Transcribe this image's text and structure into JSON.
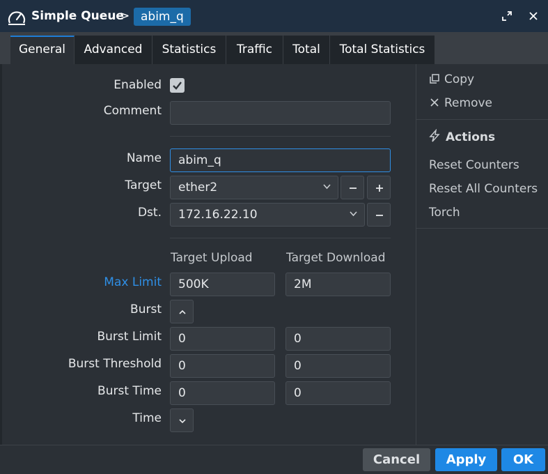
{
  "titlebar": {
    "app_title": "Simple Queue",
    "separator": ">",
    "item_name": "abim_q"
  },
  "tabs": [
    {
      "label": "General",
      "active": true
    },
    {
      "label": "Advanced"
    },
    {
      "label": "Statistics"
    },
    {
      "label": "Traffic"
    },
    {
      "label": "Total"
    },
    {
      "label": "Total Statistics"
    }
  ],
  "form": {
    "enabled_label": "Enabled",
    "enabled_checked": true,
    "comment_label": "Comment",
    "comment_value": "",
    "name_label": "Name",
    "name_value": "abim_q",
    "target_label": "Target",
    "target_value": "ether2",
    "dst_label": "Dst.",
    "dst_value": "172.16.22.10",
    "col_upload": "Target Upload",
    "col_download": "Target Download",
    "max_limit_label": "Max Limit",
    "max_limit_upload": "500K",
    "max_limit_download": "2M",
    "burst_label": "Burst",
    "burst_limit_label": "Burst Limit",
    "burst_limit_upload": "0",
    "burst_limit_download": "0",
    "burst_threshold_label": "Burst Threshold",
    "burst_threshold_upload": "0",
    "burst_threshold_download": "0",
    "burst_time_label": "Burst Time",
    "burst_time_upload": "0",
    "burst_time_download": "0",
    "time_label": "Time"
  },
  "sidebar": {
    "copy_label": "Copy",
    "remove_label": "Remove",
    "actions_heading": "Actions",
    "actions": [
      "Reset Counters",
      "Reset All Counters",
      "Torch"
    ]
  },
  "footer": {
    "cancel_label": "Cancel",
    "apply_label": "Apply",
    "ok_label": "OK"
  },
  "colors": {
    "accent": "#1e88e5",
    "titlebar": "#1f2f41",
    "link": "#2f8fe6"
  }
}
